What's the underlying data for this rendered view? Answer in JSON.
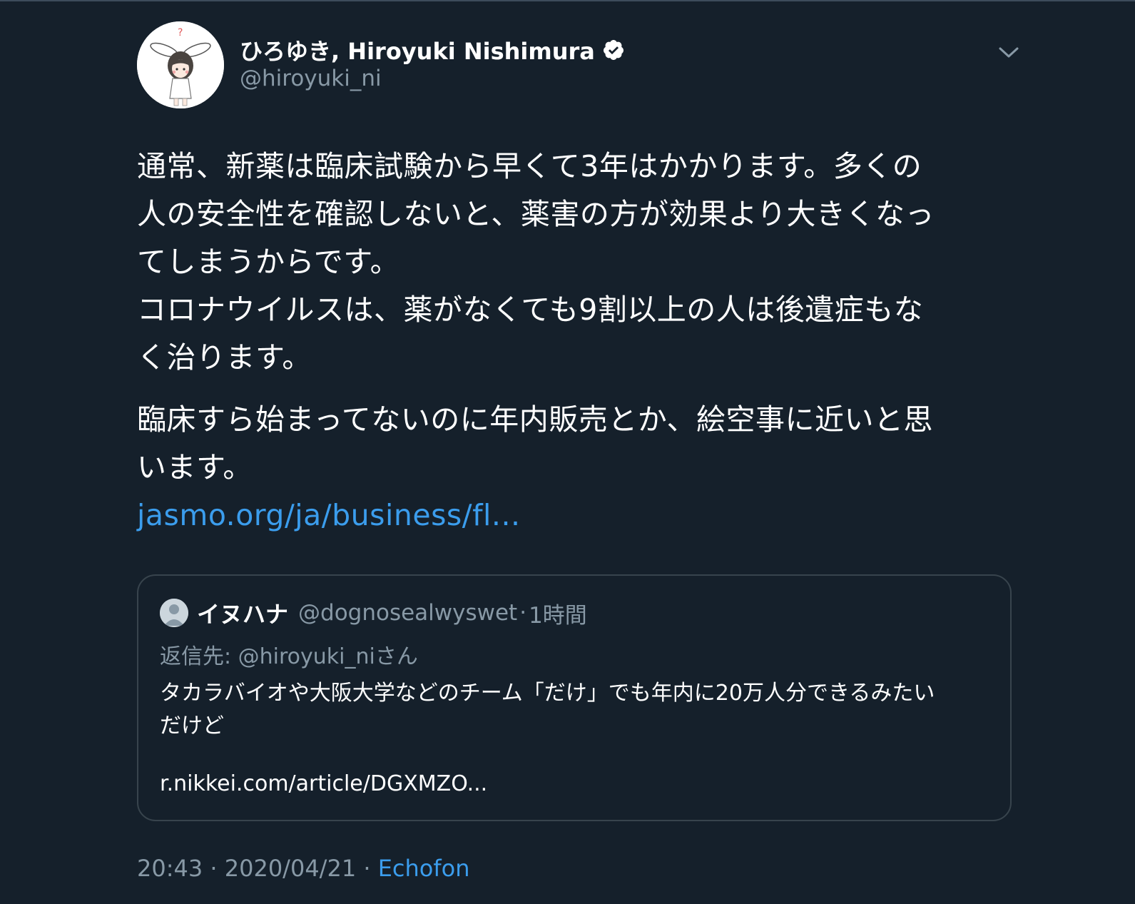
{
  "tweet": {
    "author": {
      "display_name": "ひろゆき, Hiroyuki Nishimura",
      "handle": "@hiroyuki_ni",
      "verified": true
    },
    "body": {
      "line1": "通常、新薬は臨床試験から早くて3年はかかります。多くの",
      "line2": "人の安全性を確認しないと、薬害の方が効果より大きくなっ",
      "line3": "てしまうからです。",
      "line4": "コロナウイルスは、薬がなくても9割以上の人は後遺症もな",
      "line5": "く治ります。",
      "line6": "臨床すら始まってないのに年内販売とか、絵空事に近いと思",
      "line7": "います。",
      "link": "jasmo.org/ja/business/fl..."
    },
    "quoted": {
      "display_name": "イヌハナ",
      "handle": "@dognosealwyswet",
      "separator": "·",
      "time": "1時間",
      "reply_to": "返信先: @hiroyuki_niさん",
      "text_line1": "タカラバイオや大阪大学などのチーム「だけ」でも年内に20万人分できるみたい",
      "text_line2": "だけど",
      "link": "r.nikkei.com/article/DGXMZO..."
    },
    "meta": {
      "time": "20:43",
      "sep1": " · ",
      "date": "2020/04/21",
      "sep2": " · ",
      "source": "Echofon"
    }
  },
  "icons": {
    "verified": "verified-badge-icon",
    "caret": "chevron-down-icon",
    "quoted_avatar": "default-avatar-icon"
  },
  "colors": {
    "background": "#15202b",
    "text": "#ffffff",
    "secondary": "#8899a6",
    "link": "#3b9ded",
    "border": "#38444d"
  }
}
